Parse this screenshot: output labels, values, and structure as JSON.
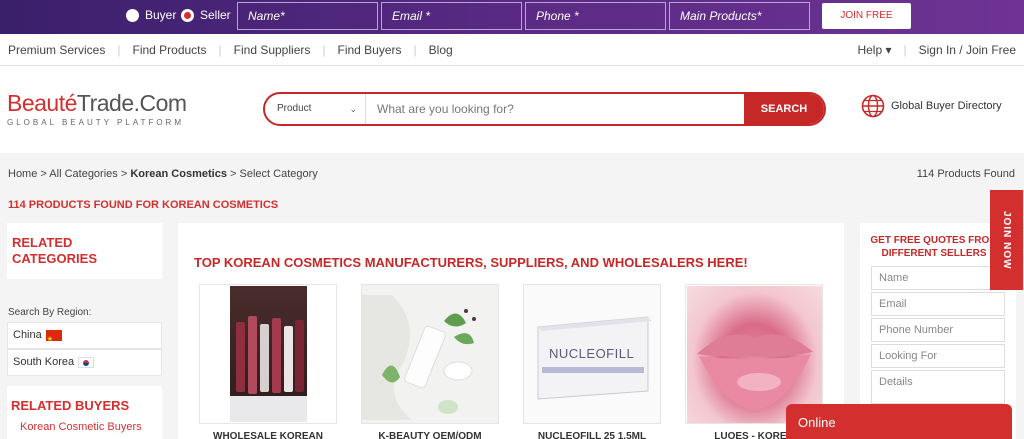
{
  "topbar": {
    "buyer_label": "Buyer",
    "seller_label": "Seller",
    "selected_role": "Seller",
    "name_placeholder": "Name*",
    "email_placeholder": "Email *",
    "phone_placeholder": "Phone *",
    "products_placeholder": "Main Products*",
    "join_label": "JOIN FREE"
  },
  "nav": {
    "left": [
      "Premium Services",
      "Find Products",
      "Find Suppliers",
      "Find Buyers",
      "Blog"
    ],
    "help": "Help ▾",
    "signin": "Sign In / Join Free"
  },
  "header": {
    "logo_part1": "Beauté",
    "logo_part2": "Trade.Com",
    "logo_tagline": "GLOBAL BEAUTY PLATFORM",
    "search_category": "Product",
    "search_placeholder": "What are you looking for?",
    "search_button": "SEARCH",
    "directory_label": "Global Buyer Directory"
  },
  "breadcrumb": {
    "home": "Home",
    "all": "All Categories",
    "current": "Korean Cosmetics",
    "select": "Select Category",
    "sep": ">"
  },
  "results": {
    "count_label": "114 Products Found",
    "found_title": "114 PRODUCTS FOUND FOR KOREAN COSMETICS"
  },
  "sidebar": {
    "related_categories": "RELATED CATEGORIES",
    "region_label": "Search By Region:",
    "regions": [
      "China",
      "South Korea"
    ],
    "related_buyers": "RELATED BUYERS",
    "buyer_link": "Korean Cosmetic Buyers"
  },
  "main": {
    "title": "TOP KOREAN COSMETICS MANUFACTURERS, SUPPLIERS, AND WHOLESALERS HERE!",
    "product_labels": [
      "WHOLESALE KOREAN",
      "K-BEAUTY OEM/ODM",
      "NUCLEOFILL 25 1.5ML",
      "LUOES - KOREA"
    ],
    "nucleo_brand": "NUCLEOFILL"
  },
  "quote": {
    "title": "GET FREE QUOTES FROM DIFFERENT SELLERS",
    "fields": [
      "Name",
      "Email",
      "Phone Number",
      "Looking For",
      "Details"
    ]
  },
  "floating": {
    "join_now": "JOIN NOW",
    "online": "Online"
  }
}
